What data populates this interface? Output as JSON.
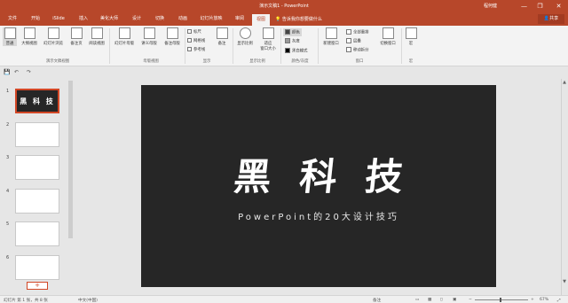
{
  "titlebar": {
    "document_title": "演示文稿1 - PowerPoint",
    "user_name": "程何健",
    "minimize": "—",
    "restore": "❐",
    "close": "✕"
  },
  "tabs": [
    {
      "label": "文件"
    },
    {
      "label": "开始"
    },
    {
      "label": "iSlide"
    },
    {
      "label": "插入"
    },
    {
      "label": "美化大师"
    },
    {
      "label": "设计"
    },
    {
      "label": "切换"
    },
    {
      "label": "动画"
    },
    {
      "label": "幻灯片放映"
    },
    {
      "label": "审阅"
    },
    {
      "label": "视图"
    }
  ],
  "active_tab": "视图",
  "tell_me": "告诉我你想要做什么",
  "share_label": "共享",
  "ribbon": {
    "views": [
      {
        "label": "普通"
      },
      {
        "label": "大纲视图"
      },
      {
        "label": "幻灯片浏览"
      },
      {
        "label": "备注页"
      },
      {
        "label": "阅读视图"
      }
    ],
    "views_group": "演示文稿视图",
    "master": [
      {
        "label": "幻灯片母版"
      },
      {
        "label": "讲义母版"
      },
      {
        "label": "备注母版"
      }
    ],
    "master_group": "母版视图",
    "show": {
      "ruler": "标尺",
      "gridlines": "网格线",
      "guides": "参考线"
    },
    "show_group": "显示",
    "notes_label": "备注",
    "zoom": [
      {
        "label": "显示比例"
      },
      {
        "label": "适应\n窗口大小"
      }
    ],
    "zoom_group": "显示比例",
    "color": {
      "color": "颜色",
      "grayscale": "灰度",
      "bw": "黑白模式"
    },
    "color_group": "颜色/灰度",
    "window": {
      "new_window": "新建窗口",
      "arrange_all": "全部重排",
      "cascade": "层叠",
      "move_split": "移动拆分",
      "switch_windows": "切换窗口"
    },
    "window_group": "窗口",
    "macros_label": "宏",
    "macros_group": "宏"
  },
  "thumbnails": [
    {
      "num": "1",
      "title": "黑 科 技"
    },
    {
      "num": "2"
    },
    {
      "num": "3"
    },
    {
      "num": "4"
    },
    {
      "num": "5"
    },
    {
      "num": "6"
    }
  ],
  "slide": {
    "title": "黑科技",
    "subtitle": "PowerPoint的20大设计技巧"
  },
  "statusbar": {
    "slide_info": "幻灯片 第 1 张，共 8 张",
    "language": "中文(中国)",
    "notes": "备注",
    "zoom_minus": "−",
    "zoom_plus": "+",
    "zoom_level": "67%"
  },
  "colors": {
    "accent": "#b7472a",
    "slide_bg": "#262626"
  }
}
